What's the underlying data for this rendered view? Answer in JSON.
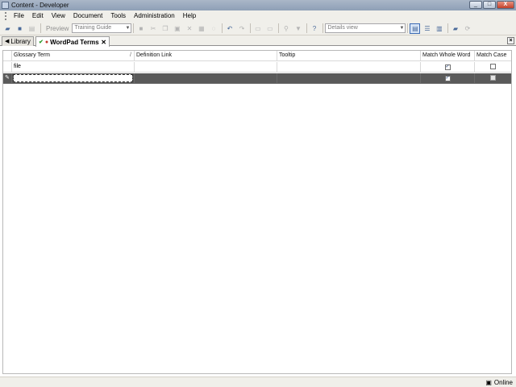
{
  "window": {
    "title": "Content - Developer",
    "minimize": "_",
    "maximize": "□",
    "close": "X"
  },
  "menu": [
    "File",
    "Edit",
    "View",
    "Document",
    "Tools",
    "Administration",
    "Help"
  ],
  "toolbar": {
    "preview_label": "Preview",
    "guide_combo": "Training Guide",
    "view_combo": "Details view"
  },
  "tabs": {
    "library": "Library",
    "active": "WordPad Terms",
    "close_glyph": "✕"
  },
  "grid": {
    "columns": {
      "term": "Glossary Term",
      "definition": "Definition Link",
      "tooltip": "Tooltip",
      "match_whole": "Match Whole Word",
      "match_case": "Match Case"
    },
    "rows": [
      {
        "term": "file",
        "definition": "",
        "tooltip": "",
        "match_whole": true,
        "match_case": false
      },
      {
        "term": "",
        "definition": "",
        "tooltip": "",
        "match_whole": true,
        "match_case": false
      }
    ],
    "sort_marker": "/",
    "check_glyph": "✓",
    "edit_glyph": "✎"
  },
  "status": {
    "online": "Online"
  }
}
